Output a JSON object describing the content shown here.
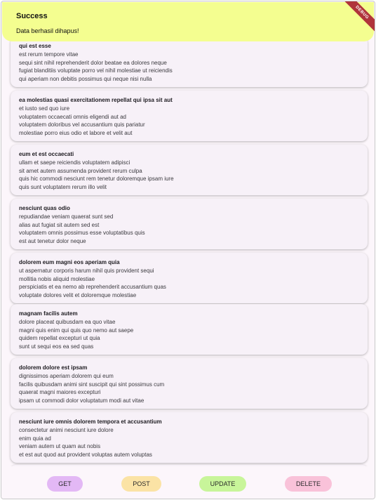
{
  "snackbar": {
    "title": "Success",
    "message": "Data berhasil dihapus!"
  },
  "debug_banner": "DEBUG",
  "posts": [
    {
      "title": "qui est esse",
      "body": "est rerum tempore vitae\nsequi sint nihil reprehenderit dolor beatae ea dolores neque\nfugiat blanditiis voluptate porro vel nihil molestiae ut reiciendis\nqui aperiam non debitis possimus qui neque nisi nulla"
    },
    {
      "title": "ea molestias quasi exercitationem repellat qui ipsa sit aut",
      "body": "et iusto sed quo iure\nvoluptatem occaecati omnis eligendi aut ad\nvoluptatem doloribus vel accusantium quis pariatur\nmolestiae porro eius odio et labore et velit aut"
    },
    {
      "title": "eum et est occaecati",
      "body": "ullam et saepe reiciendis voluptatem adipisci\nsit amet autem assumenda provident rerum culpa\nquis hic commodi nesciunt rem tenetur doloremque ipsam iure\nquis sunt voluptatem rerum illo velit"
    },
    {
      "title": "nesciunt quas odio",
      "body": "repudiandae veniam quaerat sunt sed\nalias aut fugiat sit autem sed est\nvoluptatem omnis possimus esse voluptatibus quis\nest aut tenetur dolor neque"
    },
    {
      "title": "dolorem eum magni eos aperiam quia",
      "body": "ut aspernatur corporis harum nihil quis provident sequi\nmollitia nobis aliquid molestiae\nperspiciatis et ea nemo ab reprehenderit accusantium quas\nvoluptate dolores velit et doloremque molestiae"
    },
    {
      "title": "magnam facilis autem",
      "body": "dolore placeat quibusdam ea quo vitae\nmagni quis enim qui quis quo nemo aut saepe\nquidem repellat excepturi ut quia\nsunt ut sequi eos ea sed quas"
    },
    {
      "title": "dolorem dolore est ipsam",
      "body": "dignissimos aperiam dolorem qui eum\nfacilis quibusdam animi sint suscipit qui sint possimus cum\nquaerat magni maiores excepturi\nipsam ut commodi dolor voluptatum modi aut vitae"
    },
    {
      "title": "nesciunt iure omnis dolorem tempora et accusantium",
      "body": "consectetur animi nesciunt iure dolore\nenim quia ad\nveniam autem ut quam aut nobis\net est aut quod aut provident voluptas autem voluptas"
    }
  ],
  "actions": {
    "get": "GET",
    "post": "POST",
    "update": "UPDATE",
    "delete": "DELETE"
  },
  "colors": {
    "snackbar": "#f4fe90",
    "get_button": "#e3b8f5",
    "post_button": "#fbe3a5",
    "update_button": "#c8f59a",
    "delete_button": "#f9c2d9",
    "debug_ribbon": "#b0343b"
  }
}
